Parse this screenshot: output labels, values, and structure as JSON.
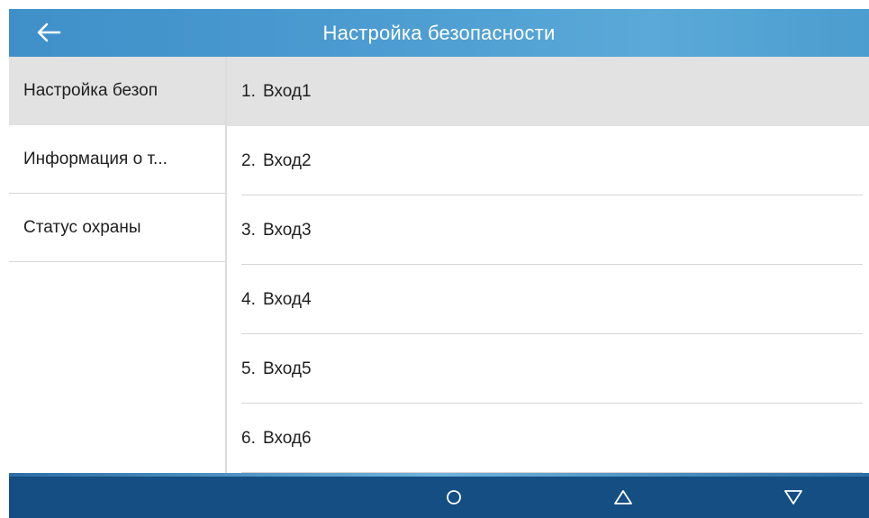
{
  "header": {
    "title": "Настройка безопасности",
    "back_icon": "arrow-left-icon"
  },
  "sidebar": {
    "items": [
      {
        "label": "Настройка безоп",
        "active": true
      },
      {
        "label": "Информация о т...",
        "active": false
      },
      {
        "label": "Статус охраны",
        "active": false
      }
    ]
  },
  "main": {
    "rows": [
      {
        "num": "1.",
        "label": "Вход1",
        "active": true
      },
      {
        "num": "2.",
        "label": "Вход2",
        "active": false
      },
      {
        "num": "3.",
        "label": "Вход3",
        "active": false
      },
      {
        "num": "4.",
        "label": "Вход4",
        "active": false
      },
      {
        "num": "5.",
        "label": "Вход5",
        "active": false
      },
      {
        "num": "6.",
        "label": "Вход6",
        "active": false
      }
    ]
  },
  "navbar": {
    "home_icon": "circle-home-icon",
    "up_icon": "triangle-up-icon",
    "down_icon": "triangle-down-icon"
  },
  "colors": {
    "header": "#4d9dd2",
    "navbar": "#154e82",
    "selected_row": "#e2e2e2"
  }
}
